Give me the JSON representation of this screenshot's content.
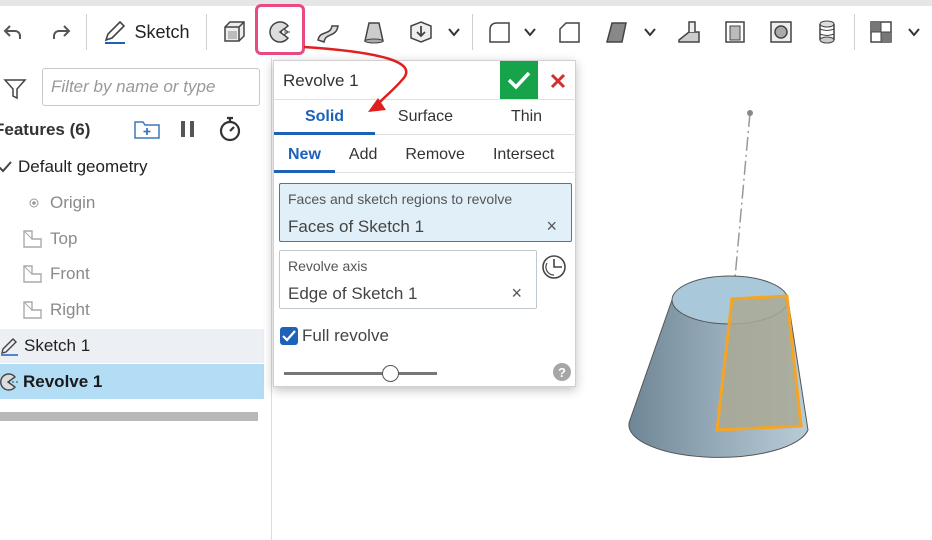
{
  "toolbar": {
    "sketch_label": "Sketch",
    "icons": [
      "undo-icon",
      "redo-icon",
      "sketch-pencil-icon",
      "extrude-icon",
      "revolve-icon",
      "sweep-icon",
      "loft-icon",
      "thicken-icon",
      "chevron-down-icon",
      "fillet-icon",
      "chevron-down-icon",
      "chamfer-icon",
      "draft-icon",
      "chevron-down-icon",
      "rib-icon",
      "shell-icon",
      "hole-icon",
      "thread-icon",
      "boolean-icon",
      "chevron-down-icon"
    ],
    "highlight_color": "#e94a86"
  },
  "feature_panel": {
    "filter_placeholder": "Filter by name or type",
    "title": "Features (6)",
    "items": [
      {
        "label": "Default geometry",
        "icon": "checkmark-icon"
      },
      {
        "label": "Origin",
        "icon": "origin-icon"
      },
      {
        "label": "Top",
        "icon": "plane-icon"
      },
      {
        "label": "Front",
        "icon": "plane-icon"
      },
      {
        "label": "Right",
        "icon": "plane-icon"
      },
      {
        "label": "Sketch 1",
        "icon": "sketch-pencil-icon"
      },
      {
        "label": "Revolve 1",
        "icon": "revolve-icon"
      }
    ]
  },
  "dialog": {
    "title": "Revolve 1",
    "tabs": [
      "Solid",
      "Surface",
      "Thin"
    ],
    "active_tab": "Solid",
    "operations": [
      "New",
      "Add",
      "Remove",
      "Intersect"
    ],
    "active_operation": "New",
    "faces_label": "Faces and sketch regions to revolve",
    "faces_value": "Faces of Sketch 1",
    "axis_label": "Revolve axis",
    "axis_value": "Edge of Sketch 1",
    "clear_glyph": "×",
    "full_revolve_label": "Full revolve",
    "full_revolve_checked": true,
    "help_glyph": "?",
    "accent": "#1e62b8",
    "ok_color": "#16a34a",
    "cancel_color": "#d32f2f"
  },
  "viewport": {
    "shape": "truncated-cone",
    "selected_face_color": "#f5a524"
  }
}
